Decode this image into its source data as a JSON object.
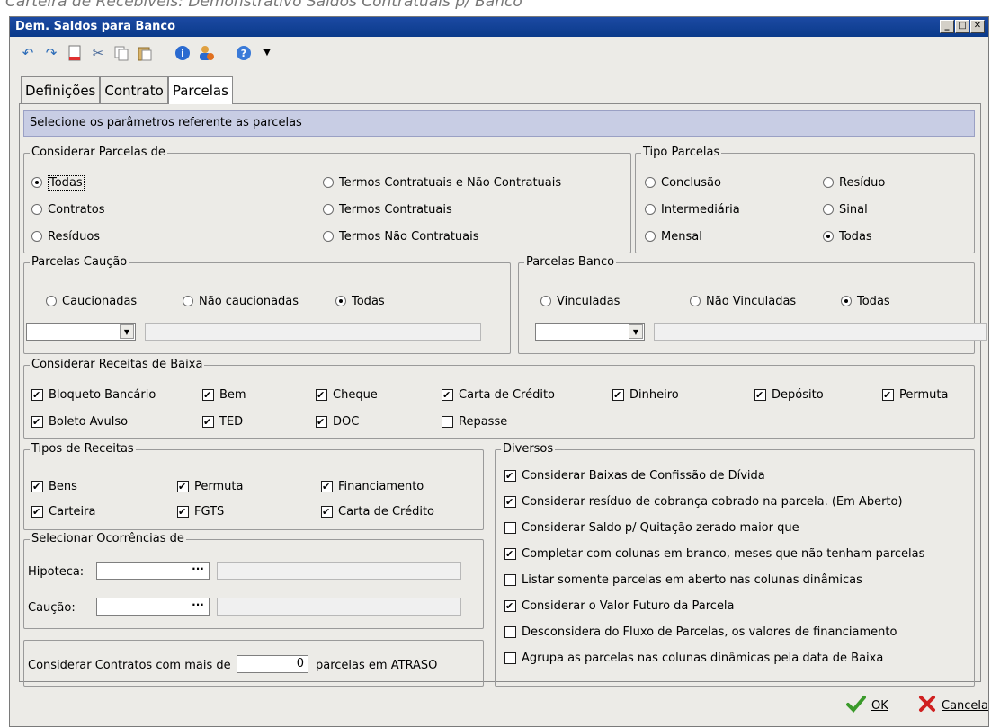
{
  "caption": "Carteira de Recebíveis: Demonstrativo Saldos Contratuais p/ Banco",
  "window": {
    "title": "Dem. Saldos para Banco"
  },
  "toolbar": {
    "icons": [
      "undo-icon",
      "redo-icon",
      "new-document-icon",
      "cut-icon",
      "copy-icon",
      "paste-icon",
      "info-icon",
      "user-icon",
      "help-icon"
    ]
  },
  "tabs": [
    {
      "label": "Definições",
      "active": false
    },
    {
      "label": "Contrato",
      "active": false
    },
    {
      "label": "Parcelas",
      "active": true
    }
  ],
  "header": {
    "text": "Selecione os parâmetros referente as parcelas"
  },
  "considerar_parcelas": {
    "legend": "Considerar Parcelas de",
    "options": [
      {
        "label": "Todas",
        "checked": true
      },
      {
        "label": "Contratos",
        "checked": false
      },
      {
        "label": "Resíduos",
        "checked": false
      },
      {
        "label": "Termos Contratuais e Não Contratuais",
        "checked": false
      },
      {
        "label": "Termos Contratuais",
        "checked": false
      },
      {
        "label": "Termos Não Contratuais",
        "checked": false
      }
    ]
  },
  "tipo_parcelas": {
    "legend": "Tipo Parcelas",
    "options": [
      {
        "label": "Conclusão",
        "checked": false
      },
      {
        "label": "Intermediária",
        "checked": false
      },
      {
        "label": "Mensal",
        "checked": false
      },
      {
        "label": "Resíduo",
        "checked": false
      },
      {
        "label": "Sinal",
        "checked": false
      },
      {
        "label": "Todas",
        "checked": true
      }
    ]
  },
  "parcelas_caucao": {
    "legend": "Parcelas Caução",
    "options": [
      {
        "label": "Caucionadas",
        "checked": false
      },
      {
        "label": "Não caucionadas",
        "checked": false
      },
      {
        "label": "Todas",
        "checked": true
      }
    ],
    "combo_value": "",
    "text_value": ""
  },
  "parcelas_banco": {
    "legend": "Parcelas Banco",
    "options": [
      {
        "label": "Vinculadas",
        "checked": false
      },
      {
        "label": "Não Vinculadas",
        "checked": false
      },
      {
        "label": "Todas",
        "checked": true
      }
    ],
    "combo_value": "",
    "text_value": ""
  },
  "receitas_baixa": {
    "legend": "Considerar Receitas de Baixa",
    "items": [
      {
        "label": "Bloqueto Bancário",
        "checked": true
      },
      {
        "label": "Bem",
        "checked": true
      },
      {
        "label": "Cheque",
        "checked": true
      },
      {
        "label": "Carta de Crédito",
        "checked": true
      },
      {
        "label": "Dinheiro",
        "checked": true
      },
      {
        "label": "Depósito",
        "checked": true
      },
      {
        "label": "Permuta",
        "checked": true
      },
      {
        "label": "Boleto Avulso",
        "checked": true
      },
      {
        "label": "TED",
        "checked": true
      },
      {
        "label": "DOC",
        "checked": true
      },
      {
        "label": "Repasse",
        "checked": false
      }
    ]
  },
  "tipos_receitas": {
    "legend": "Tipos de Receitas",
    "items": [
      {
        "label": "Bens",
        "checked": true
      },
      {
        "label": "Permuta",
        "checked": true
      },
      {
        "label": "Financiamento",
        "checked": true
      },
      {
        "label": "Carteira",
        "checked": true
      },
      {
        "label": "FGTS",
        "checked": true
      },
      {
        "label": "Carta de Crédito",
        "checked": true
      }
    ]
  },
  "ocorrencias": {
    "legend": "Selecionar Ocorrências de",
    "hipoteca_label": "Hipoteca:",
    "caucao_label": "Caução:",
    "dots": "···"
  },
  "atraso": {
    "prefix": "Considerar Contratos com mais de",
    "value": "0",
    "suffix": "parcelas em ATRASO"
  },
  "diversos": {
    "legend": "Diversos",
    "items": [
      {
        "label": "Considerar Baixas de Confissão de Dívida",
        "checked": true
      },
      {
        "label": "Considerar resíduo de cobrança cobrado na parcela. (Em Aberto)",
        "checked": true
      },
      {
        "label": "Considerar Saldo p/ Quitação zerado maior que",
        "checked": false
      },
      {
        "label": "Completar com colunas em branco, meses que não tenham parcelas",
        "checked": true
      },
      {
        "label": "Listar somente parcelas em aberto nas colunas dinâmicas",
        "checked": false
      },
      {
        "label": "Considerar o Valor Futuro da Parcela",
        "checked": true
      },
      {
        "label": "Desconsidera do Fluxo de Parcelas, os valores de financiamento",
        "checked": false
      },
      {
        "label": "Agrupa as parcelas nas colunas dinâmicas pela data de Baixa",
        "checked": false
      }
    ]
  },
  "footer": {
    "ok_label": "OK",
    "cancel_label": "Cancela"
  },
  "colors": {
    "title_bar": "#0a3a8a",
    "header_strip": "#c8cde4",
    "ok_green": "#3a9a2a",
    "cancel_red": "#d02020"
  }
}
